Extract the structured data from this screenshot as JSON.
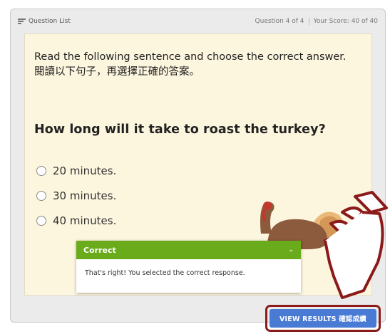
{
  "header": {
    "question_list_label": "Question List",
    "question_progress": "Question 4 of 4",
    "score_text": "Your Score: 40 of 40"
  },
  "slide": {
    "instruction_en": "Read the following sentence and choose the correct answer.",
    "instruction_zh": "閱讀以下句子，再選擇正確的答案。",
    "question": "How long will it take to roast the turkey?",
    "options": [
      "20 minutes.",
      "30 minutes.",
      "40 minutes."
    ]
  },
  "feedback": {
    "title": "Correct",
    "message": "That's right! You selected the correct response."
  },
  "footer": {
    "view_results_label": "VIEW RESULTS 確認成績"
  },
  "colors": {
    "slide_bg": "#fdf6df",
    "feedback_green": "#6aab1b",
    "button_blue": "#4a7bd4",
    "highlight_red": "#8b1a1a"
  },
  "icons": [
    "question-list-icon",
    "chevron-down-icon",
    "pointing-hand-icon",
    "turkey-illustration"
  ]
}
